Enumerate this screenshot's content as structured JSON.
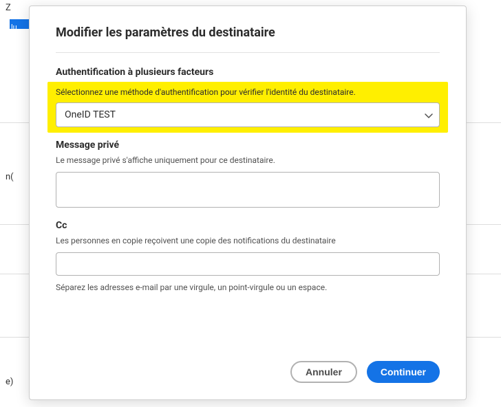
{
  "bg": {
    "text_z": "Z",
    "text_lu": "lu",
    "text_n": "n(",
    "text_e": "e)"
  },
  "modal": {
    "title": "Modifier les paramètres du destinataire",
    "auth": {
      "heading": "Authentification à plusieurs facteurs",
      "help": "Sélectionnez une méthode d'authentification pour vérifier l'identité du destinataire.",
      "selected": "OneID TEST"
    },
    "private_message": {
      "heading": "Message privé",
      "help": "Le message privé s'affiche uniquement pour ce destinataire.",
      "value": ""
    },
    "cc": {
      "heading": "Cc",
      "help": "Les personnes en copie reçoivent une copie des notifications du destinataire",
      "value": "",
      "hint": "Séparez les adresses e-mail par une virgule, un point-virgule ou un espace."
    },
    "footer": {
      "cancel": "Annuler",
      "continue": "Continuer"
    }
  }
}
